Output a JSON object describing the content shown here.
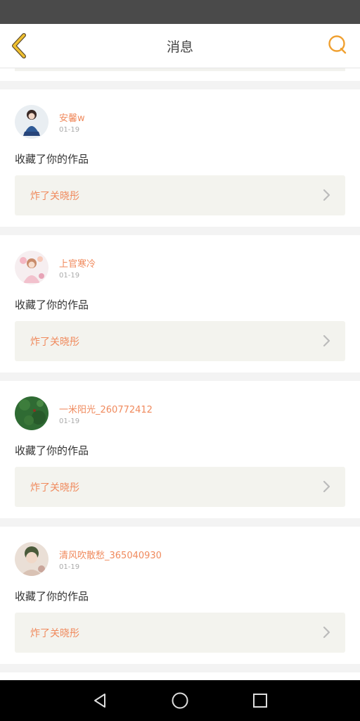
{
  "header": {
    "title": "消息",
    "back_icon": "chevron-left-icon",
    "search_icon": "chat-bubble-icon",
    "accent_color": "#f0a030"
  },
  "messages": [
    {
      "user": "安馨w",
      "time": "01-19",
      "text": "收藏了你的作品",
      "work": "炸了关晓彤"
    },
    {
      "user": "上官寒冷",
      "time": "01-19",
      "text": "收藏了你的作品",
      "work": "炸了关晓彤"
    },
    {
      "user": "一米阳光_260772412",
      "time": "01-19",
      "text": "收藏了你的作品",
      "work": "炸了关晓彤"
    },
    {
      "user": "清风吹散愁_365040930",
      "time": "01-19",
      "text": "收藏了你的作品",
      "work": "炸了关晓彤"
    }
  ],
  "colors": {
    "link_text": "#f08a5d",
    "link_background": "#f3f3ee",
    "page_background": "#f3f3f3"
  },
  "nav": {
    "back_icon": "triangle-back-icon",
    "home_icon": "circle-home-icon",
    "recents_icon": "square-recents-icon"
  }
}
